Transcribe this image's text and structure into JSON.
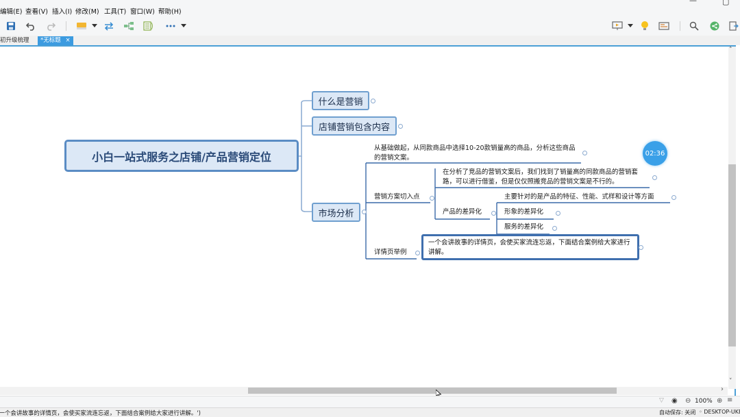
{
  "menus": [
    "编辑(E)",
    "查看(V)",
    "插入(I)",
    "修改(M)",
    "工具(T)",
    "窗口(W)",
    "帮助(H)"
  ],
  "tabs": [
    {
      "label": "初升级梳理",
      "active": false
    },
    {
      "label": "*无标题",
      "active": true,
      "close": "×"
    }
  ],
  "mindmap": {
    "central": "小白一站式服务之店铺/产品营销定位",
    "topics": {
      "what_is_marketing": "什么是营销",
      "store_marketing": "店铺营销包含内容",
      "market_analysis": "市场分析"
    },
    "market_analysis": {
      "intro_note": "从基础做起，从同款商品中选择10-20款销量高的商品，分析这些商品的营销文案。",
      "entry_point": "营销方案切入点",
      "entry_note": "在分析了竞品的营销文案后，我们找到了销量高的同款商品的营销套路，可以进行借鉴，但是仅仅照搬竞品的营销文案是不行的。",
      "differentiation": "产品的差异化",
      "diff_items": [
        "主要针对的是产品的特征、性能、式样和设计等方面",
        "形象的差异化",
        "服务的差异化"
      ],
      "detail_example": "详情页举例",
      "detail_note": "一个会讲故事的详情页，会使买家流连忘返，下面结合案例给大家进行讲解。"
    }
  },
  "timer": "02:36",
  "zoom": "100%",
  "status": {
    "selection": "'一个会讲故事的详情页，会使买家流连忘返，下面结合案例给大家进行讲解。')",
    "autosave": "自动保存: 关闭",
    "computer": "DESKTOP-UKE"
  },
  "colors": {
    "accent": "#4a9fd6",
    "topic_fill": "#dce8f6",
    "topic_border": "#6f9fcf",
    "timer": "#3aa0e8"
  }
}
